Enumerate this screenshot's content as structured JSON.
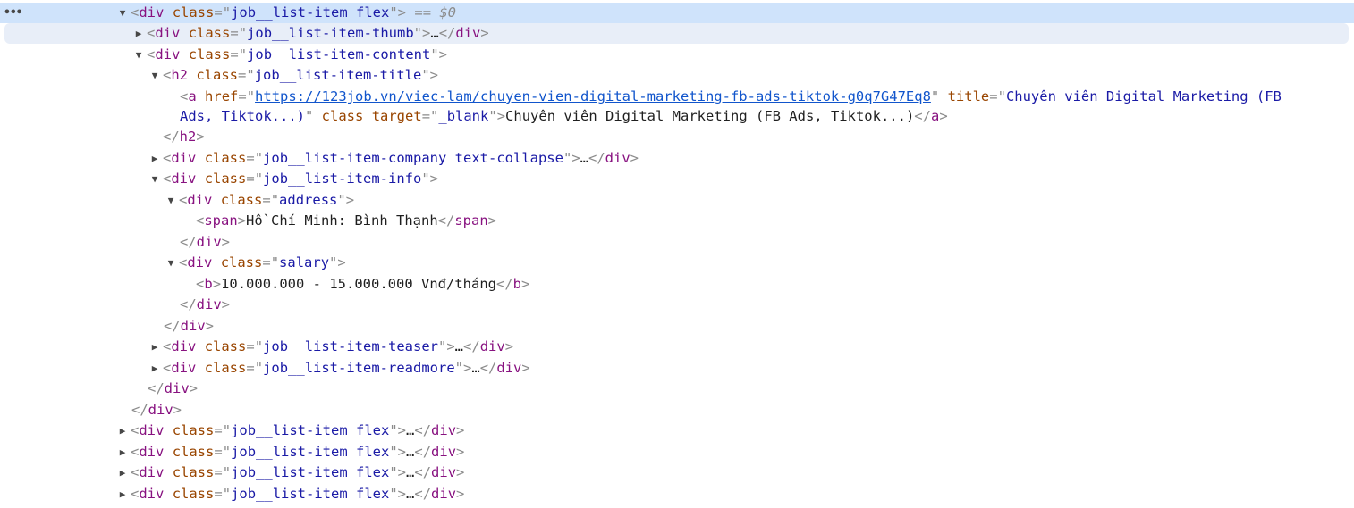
{
  "elements_panel": {
    "gutter_menu": "•••",
    "selected_marker": "== $0",
    "rows": {
      "root_class": "job__list-item flex",
      "thumb_class": "job__list-item-thumb",
      "content_class": "job__list-item-content",
      "title_class": "job__list-item-title",
      "link_href": "https://123job.vn/viec-lam/chuyen-vien-digital-marketing-fb-ads-tiktok-g0q7G47Eq8",
      "link_title_part1": "Chuyên viên Digital Marketing (FB",
      "link_title_part2": "Ads, Tiktok...)",
      "link_target": "_blank",
      "link_text": "Chuyên viên Digital Marketing (FB Ads, Tiktok...)",
      "company_class": "job__list-item-company text-collapse",
      "info_class": "job__list-item-info",
      "address_class": "address",
      "address_text": "Hồ Chí Minh: Bình Thạnh",
      "salary_class": "salary",
      "salary_text": "10.000.000 - 15.000.000 Vnđ/tháng",
      "teaser_class": "job__list-item-teaser",
      "readmore_class": "job__list-item-readmore",
      "sibling_class": "job__list-item flex"
    },
    "labels": {
      "div": "div",
      "h2": "h2",
      "a": "a",
      "span": "span",
      "b": "b",
      "attr_class": "class",
      "attr_href": "href",
      "attr_title": "title",
      "attr_target": "target",
      "ellipsis": "…"
    }
  }
}
